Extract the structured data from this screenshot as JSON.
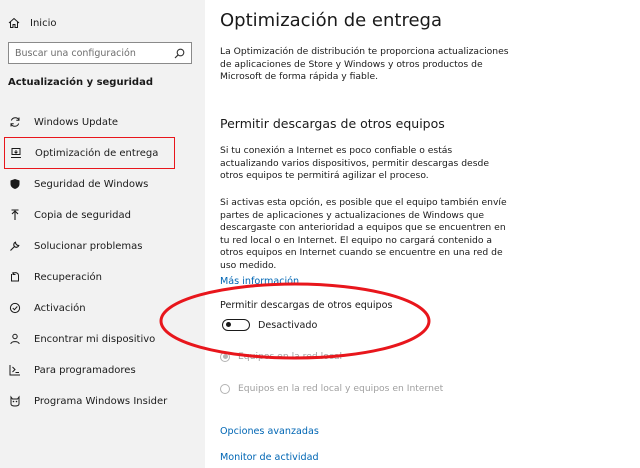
{
  "sidebar": {
    "home_label": "Inicio",
    "search_placeholder": "Buscar una configuración",
    "section_title": "Actualización y seguridad",
    "items": [
      {
        "label": "Windows Update",
        "icon": "sync-icon"
      },
      {
        "label": "Optimización de entrega",
        "icon": "delivery-optimization-icon",
        "selected": true
      },
      {
        "label": "Seguridad de Windows",
        "icon": "shield-icon"
      },
      {
        "label": "Copia de seguridad",
        "icon": "backup-arrow-icon"
      },
      {
        "label": "Solucionar problemas",
        "icon": "wrench-icon"
      },
      {
        "label": "Recuperación",
        "icon": "recovery-icon"
      },
      {
        "label": "Activación",
        "icon": "activation-check-icon"
      },
      {
        "label": "Encontrar mi dispositivo",
        "icon": "find-person-icon"
      },
      {
        "label": "Para programadores",
        "icon": "developer-tools-icon"
      },
      {
        "label": "Programa Windows Insider",
        "icon": "insider-cat-icon"
      }
    ]
  },
  "main": {
    "title": "Optimización de entrega",
    "intro": "La Optimización de distribución te proporciona actualizaciones de aplicaciones de Store y Windows y otros productos de Microsoft de forma rápida y fiable.",
    "subheading": "Permitir descargas de otros equipos",
    "para1": "Si tu conexión a Internet es poco confiable o estás actualizando varios dispositivos, permitir descargas desde otros equipos te permitirá agilizar el proceso.",
    "para2": "Si activas esta opción, es posible que el equipo también envíe partes de aplicaciones y actualizaciones de Windows que descargaste con anterioridad a equipos que se encuentren en tu red local o en Internet. El equipo no cargará contenido a otros equipos en Internet cuando se encuentre en una red de uso medido.",
    "more_info_link": "Más información",
    "toggle_label": "Permitir descargas de otros equipos",
    "toggle_state": "Desactivado",
    "toggle_on": false,
    "radio_local": "Equipos en la red local",
    "radio_local_internet": "Equipos en la red local y equipos en Internet",
    "advanced_link": "Opciones avanzadas",
    "activity_link": "Monitor de actividad"
  },
  "colors": {
    "accent_link": "#0066b4",
    "selection_border": "#e8161c",
    "annotation_ellipse": "#e8161c",
    "sidebar_bg": "#f2f2f2"
  }
}
